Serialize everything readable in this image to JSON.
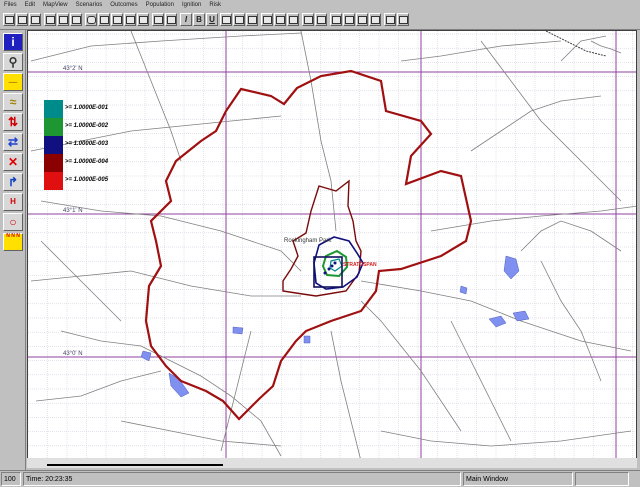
{
  "menu": [
    "Files",
    "Edit",
    "MapView",
    "Scenarios",
    "Outcomes",
    "Population",
    "Ignition",
    "Risk"
  ],
  "toolbar_text_buttons": [
    "I",
    "B",
    "U"
  ],
  "legend": {
    "items": [
      {
        "label": ">= 1.0000E-001",
        "color": "#008b8b"
      },
      {
        "label": ">= 1.0000E-002",
        "color": "#1e9632"
      },
      {
        "label": ">= 1.0000E-003",
        "color": "#101080"
      },
      {
        "label": ">= 1.0000E-004",
        "color": "#8b0000"
      },
      {
        "label": ">= 1.0000E-005",
        "color": "#e01010"
      }
    ]
  },
  "map": {
    "latitudes": [
      "43°2' N",
      "43°1' N",
      "43°0' N"
    ],
    "place_name": "Rockingham Park",
    "facility_label": "STRATOSPAN"
  },
  "sidebar": [
    "info-icon",
    "search-icon",
    "measure-icon",
    "route-icon",
    "swap-icon",
    "arrows-icon",
    "close-icon",
    "up-icon",
    "height-icon",
    "pin-icon",
    "notes-icon"
  ],
  "status": {
    "zoom": "100",
    "time": "Time: 20:23:35",
    "window": "Main Window"
  }
}
